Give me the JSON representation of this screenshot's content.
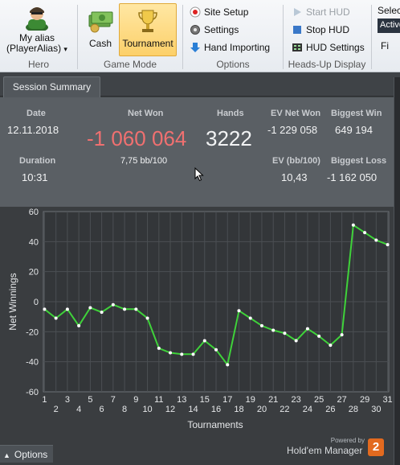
{
  "ribbon": {
    "hero": {
      "alias": "My alias",
      "player": "(PlayerAlias)",
      "dropdown": "▾",
      "group_title": "Hero"
    },
    "game_mode": {
      "cash": "Cash",
      "tournament": "Tournament",
      "group_title": "Game Mode"
    },
    "options": {
      "site_setup": "Site Setup",
      "settings": "Settings",
      "hand_importing": "Hand Importing",
      "group_title": "Options"
    },
    "hud": {
      "start_hud": "Start HUD",
      "stop_hud": "Stop HUD",
      "hud_settings": "HUD Settings",
      "group_title": "Heads-Up Display"
    },
    "right": {
      "select_label": "Select",
      "combo_value": "Active",
      "fi_label": "Fi"
    }
  },
  "tabs": {
    "session_summary": "Session Summary"
  },
  "summary": {
    "date_label": "Date",
    "date": "12.11.2018",
    "netwon_label": "Net Won",
    "netwon": "-1 060 064",
    "bb100": "7,75 bb/100",
    "hands_label": "Hands",
    "hands": "3222",
    "ev_net_won_label": "EV Net Won",
    "ev_net_won": "-1 229 058",
    "biggest_win_label": "Biggest Win",
    "biggest_win": "649 194",
    "duration_label": "Duration",
    "duration": "10:31",
    "ev_bb100_label": "EV (bb/100)",
    "ev_bb100": "10,43",
    "biggest_loss_label": "Biggest Loss",
    "biggest_loss": "-1 162 050"
  },
  "chart_data": {
    "type": "line",
    "xlabel": "Tournaments",
    "ylabel": "Net Winnings",
    "ylim": [
      -60,
      60
    ],
    "yticks": [
      60,
      40,
      20,
      0,
      -20,
      -40,
      -60
    ],
    "x": [
      1,
      2,
      3,
      4,
      5,
      6,
      7,
      8,
      9,
      10,
      11,
      12,
      13,
      14,
      15,
      16,
      17,
      18,
      19,
      20,
      21,
      22,
      23,
      24,
      25,
      26,
      27,
      28,
      29,
      30,
      31
    ],
    "series": [
      {
        "values": [
          -5,
          -11,
          -5,
          -16,
          -4,
          -7,
          -2,
          -5,
          -5,
          -11,
          -31,
          -34,
          -35,
          -35,
          -26,
          -32,
          -42,
          -6,
          -11,
          -16,
          -19,
          -21,
          -26,
          -18,
          -23,
          -29,
          -22,
          51,
          46,
          41,
          38
        ]
      }
    ],
    "grid": true,
    "line_color": "#3fd23a"
  },
  "footer": {
    "options": "Options",
    "options_arrow": "▲",
    "powered": "Powered by",
    "brand": "Hold'em Manager",
    "badge": "2"
  }
}
